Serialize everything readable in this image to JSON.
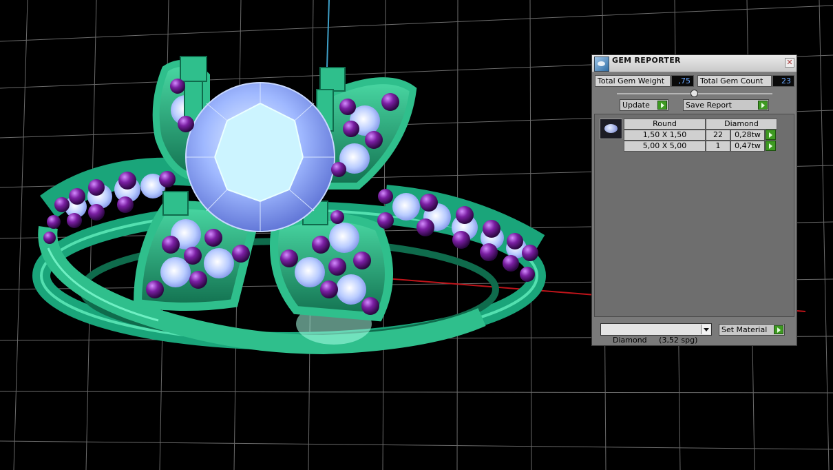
{
  "gem_reporter": {
    "title": "GEM REPORTER",
    "close_glyph": "✕",
    "total_gem_weight_label": "Total Gem Weight",
    "total_gem_weight_value": ",75",
    "total_gem_count_label": "Total Gem Count",
    "total_gem_count_value": "23",
    "update_label": "Update",
    "save_report_label": "Save Report",
    "table": {
      "shape_header": "Round",
      "material_header": "Diamond",
      "rows": [
        {
          "size": "1,50 X 1,50",
          "count": "22",
          "weight": "0,28tw"
        },
        {
          "size": "5,00 X 5,00",
          "count": "1",
          "weight": "0,47tw"
        }
      ]
    },
    "material_select_value": "Diamond     (3,52 spg)",
    "set_material_label": "Set Material"
  },
  "colors": {
    "metal": "#2fbf8c",
    "center_stone": "#9fb8ff",
    "accent_stones": "#7a1fa2",
    "grid": "#6b6b6b",
    "axis_red": "#c0141a",
    "axis_blue": "#3fa0c8"
  },
  "icons": {
    "app": "gem-reporter-app-icon",
    "close": "close-icon",
    "play": "play-icon",
    "dropdown": "chevron-down-icon",
    "gem": "round-diamond-icon"
  }
}
